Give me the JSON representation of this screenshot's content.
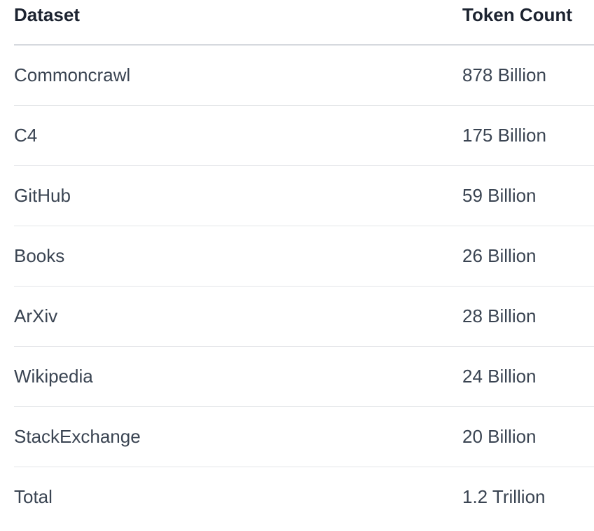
{
  "table": {
    "headers": {
      "dataset": "Dataset",
      "token_count": "Token Count"
    },
    "rows": [
      {
        "dataset": "Commoncrawl",
        "token_count": "878 Billion"
      },
      {
        "dataset": "C4",
        "token_count": "175 Billion"
      },
      {
        "dataset": "GitHub",
        "token_count": "59 Billion"
      },
      {
        "dataset": "Books",
        "token_count": "26 Billion"
      },
      {
        "dataset": "ArXiv",
        "token_count": "28 Billion"
      },
      {
        "dataset": "Wikipedia",
        "token_count": "24 Billion"
      },
      {
        "dataset": "StackExchange",
        "token_count": "20 Billion"
      },
      {
        "dataset": "Total",
        "token_count": "1.2 Trillion"
      }
    ]
  }
}
